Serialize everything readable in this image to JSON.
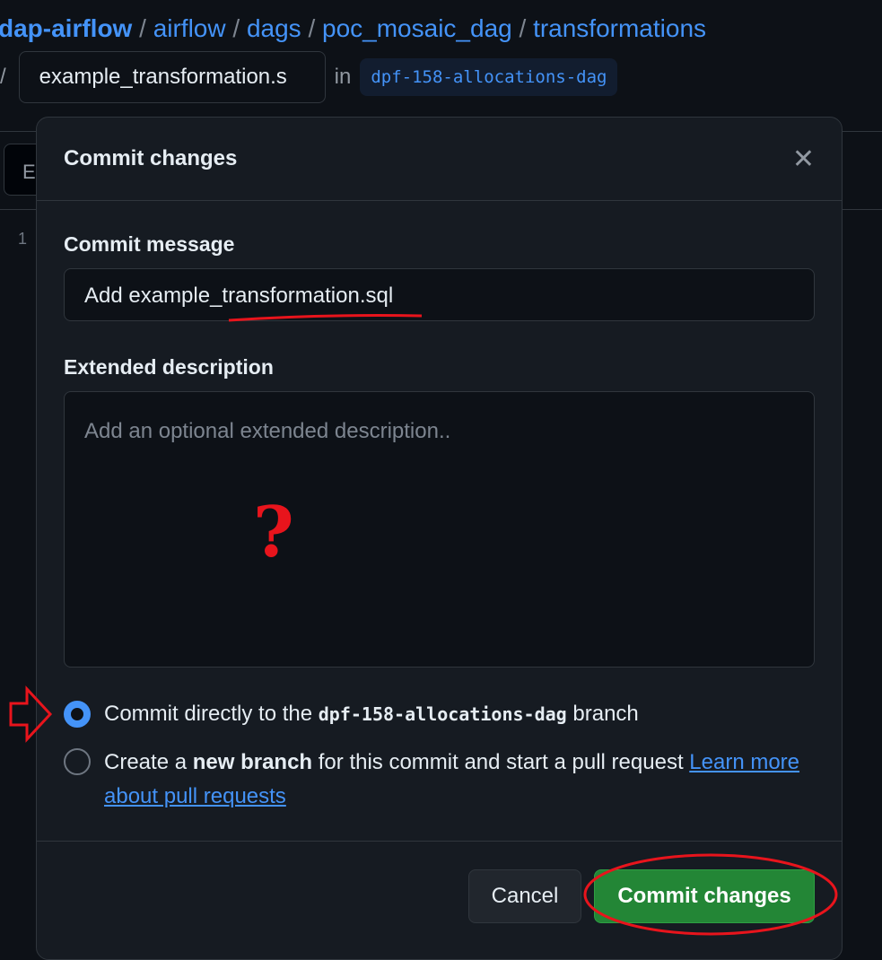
{
  "breadcrumb": {
    "items": [
      "dap-airflow",
      "airflow",
      "dags",
      "poc_mosaic_dag",
      "transformations"
    ],
    "separator": "/"
  },
  "file": {
    "name_value": "example_transformation.s",
    "in_label": "in",
    "branch": "dpf-158-allocations-dag"
  },
  "editor": {
    "tab_partial": "E",
    "line_number": "1"
  },
  "dialog": {
    "title": "Commit changes",
    "close_icon": "x-icon",
    "commit_message_label": "Commit message",
    "commit_message_value": "Add example_transformation.sql",
    "extended_label": "Extended description",
    "extended_placeholder": "Add an optional extended description..",
    "option_direct": {
      "prefix": "Commit directly to the",
      "branch": "dpf-158-allocations-dag",
      "suffix": "branch",
      "selected": true
    },
    "option_new": {
      "prefix": "Create a",
      "bold": "new branch",
      "suffix": "for this commit and start a pull request",
      "link": "Learn more about pull requests",
      "selected": false
    },
    "cancel_label": "Cancel",
    "commit_label": "Commit changes"
  },
  "annotations": {
    "question_mark": "?",
    "color": "#e8141c"
  },
  "colors": {
    "accent": "#4493f8",
    "primary_button": "#238636",
    "background": "#0d1117",
    "dialog": "#161b22"
  }
}
